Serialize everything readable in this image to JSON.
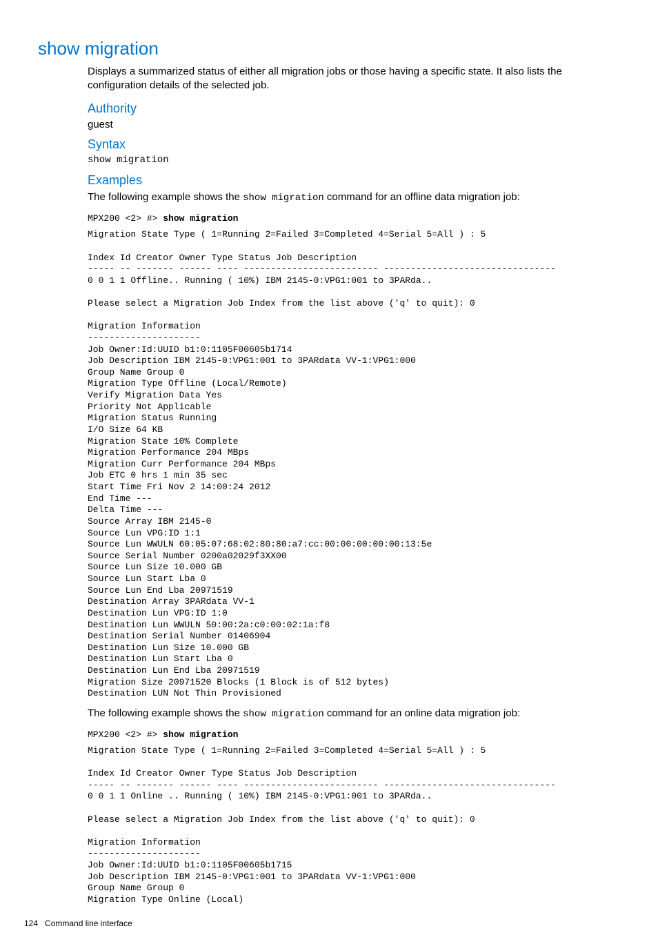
{
  "title": "show migration",
  "description": "Displays a summarized status of either all migration jobs or those having a specific state. It also lists the configuration details of the selected job.",
  "authority_heading": "Authority",
  "authority_value": "guest",
  "syntax_heading": "Syntax",
  "syntax_value": "show migration",
  "examples_heading": "Examples",
  "example1_intro_prefix": "The following example shows the ",
  "example1_intro_cmd": "show migration",
  "example1_intro_suffix": " command for an offline data migration job:",
  "prompt_prefix": "MPX200 <2> #> ",
  "prompt_command": "show migration",
  "example1_output": "Migration State Type ( 1=Running 2=Failed 3=Completed 4=Serial 5=All ) : 5\n\nIndex Id Creator Owner Type Status Job Description\n----- -- ------- ------ ---- ------------------------- --------------------------------\n0 0 1 1 Offline.. Running ( 10%) IBM 2145-0:VPG1:001 to 3PARda..\n\nPlease select a Migration Job Index from the list above ('q' to quit): 0\n\nMigration Information\n---------------------\nJob Owner:Id:UUID b1:0:1105F00605b1714\nJob Description IBM 2145-0:VPG1:001 to 3PARdata VV-1:VPG1:000\nGroup Name Group 0\nMigration Type Offline (Local/Remote)\nVerify Migration Data Yes\nPriority Not Applicable\nMigration Status Running\nI/O Size 64 KB\nMigration State 10% Complete\nMigration Performance 204 MBps\nMigration Curr Performance 204 MBps\nJob ETC 0 hrs 1 min 35 sec\nStart Time Fri Nov 2 14:00:24 2012\nEnd Time ---\nDelta Time ---\nSource Array IBM 2145-0\nSource Lun VPG:ID 1:1\nSource Lun WWULN 60:05:07:68:02:80:80:a7:cc:00:00:00:00:00:13:5e\nSource Serial Number 0200a02029f3XX00\nSource Lun Size 10.000 GB\nSource Lun Start Lba 0\nSource Lun End Lba 20971519\nDestination Array 3PARdata VV-1\nDestination Lun VPG:ID 1:0\nDestination Lun WWULN 50:00:2a:c0:00:02:1a:f8\nDestination Serial Number 01406904\nDestination Lun Size 10.000 GB\nDestination Lun Start Lba 0\nDestination Lun End Lba 20971519\nMigration Size 20971520 Blocks (1 Block is of 512 bytes)\nDestination LUN Not Thin Provisioned",
  "example2_intro_prefix": "The following example shows the ",
  "example2_intro_cmd": "show migration",
  "example2_intro_suffix": " command for an online data migration job:",
  "example2_output": "Migration State Type ( 1=Running 2=Failed 3=Completed 4=Serial 5=All ) : 5\n\nIndex Id Creator Owner Type Status Job Description\n----- -- ------- ------ ---- ------------------------- --------------------------------\n0 0 1 1 Online .. Running ( 10%) IBM 2145-0:VPG1:001 to 3PARda..\n\nPlease select a Migration Job Index from the list above ('q' to quit): 0\n\nMigration Information\n---------------------\nJob Owner:Id:UUID b1:0:1105F00605b1715\nJob Description IBM 2145-0:VPG1:001 to 3PARdata VV-1:VPG1:000\nGroup Name Group 0\nMigration Type Online (Local)",
  "footer_page": "124",
  "footer_text": "Command line interface"
}
